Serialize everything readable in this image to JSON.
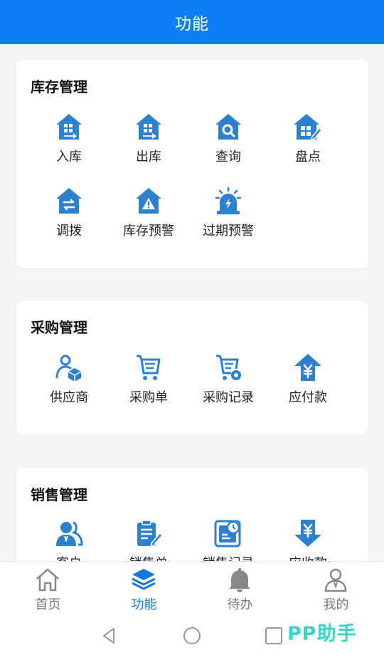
{
  "header": {
    "title": "功能"
  },
  "sections": [
    {
      "title": "库存管理",
      "items": [
        {
          "label": "入库",
          "icon": "house-in-icon"
        },
        {
          "label": "出库",
          "icon": "house-out-icon"
        },
        {
          "label": "查询",
          "icon": "house-search-icon"
        },
        {
          "label": "盘点",
          "icon": "house-edit-icon"
        },
        {
          "label": "调拨",
          "icon": "house-transfer-icon"
        },
        {
          "label": "库存预警",
          "icon": "house-warning-icon"
        },
        {
          "label": "过期预警",
          "icon": "alarm-light-icon"
        }
      ]
    },
    {
      "title": "采购管理",
      "items": [
        {
          "label": "供应商",
          "icon": "supplier-icon"
        },
        {
          "label": "采购单",
          "icon": "cart-list-icon"
        },
        {
          "label": "采购记录",
          "icon": "cart-record-icon"
        },
        {
          "label": "应付款",
          "icon": "yuan-up-icon"
        }
      ]
    },
    {
      "title": "销售管理",
      "items": [
        {
          "label": "客户",
          "icon": "customers-icon"
        },
        {
          "label": "销售单",
          "icon": "clipboard-edit-icon"
        },
        {
          "label": "销售记录",
          "icon": "record-clock-icon"
        },
        {
          "label": "应收款",
          "icon": "yuan-down-icon"
        }
      ]
    }
  ],
  "tabbar": [
    {
      "label": "首页",
      "icon": "home-icon",
      "active": false
    },
    {
      "label": "功能",
      "icon": "layers-icon",
      "active": true
    },
    {
      "label": "待办",
      "icon": "bell-icon",
      "active": false
    },
    {
      "label": "我的",
      "icon": "user-icon",
      "active": false
    }
  ],
  "watermark": "PP助手",
  "colors": {
    "primary": "#0d7ff4",
    "icon_blue": "#2d7fd0",
    "tab_active": "#1577e0",
    "tab_inactive": "#777777",
    "watermark": "#38d6c0"
  }
}
